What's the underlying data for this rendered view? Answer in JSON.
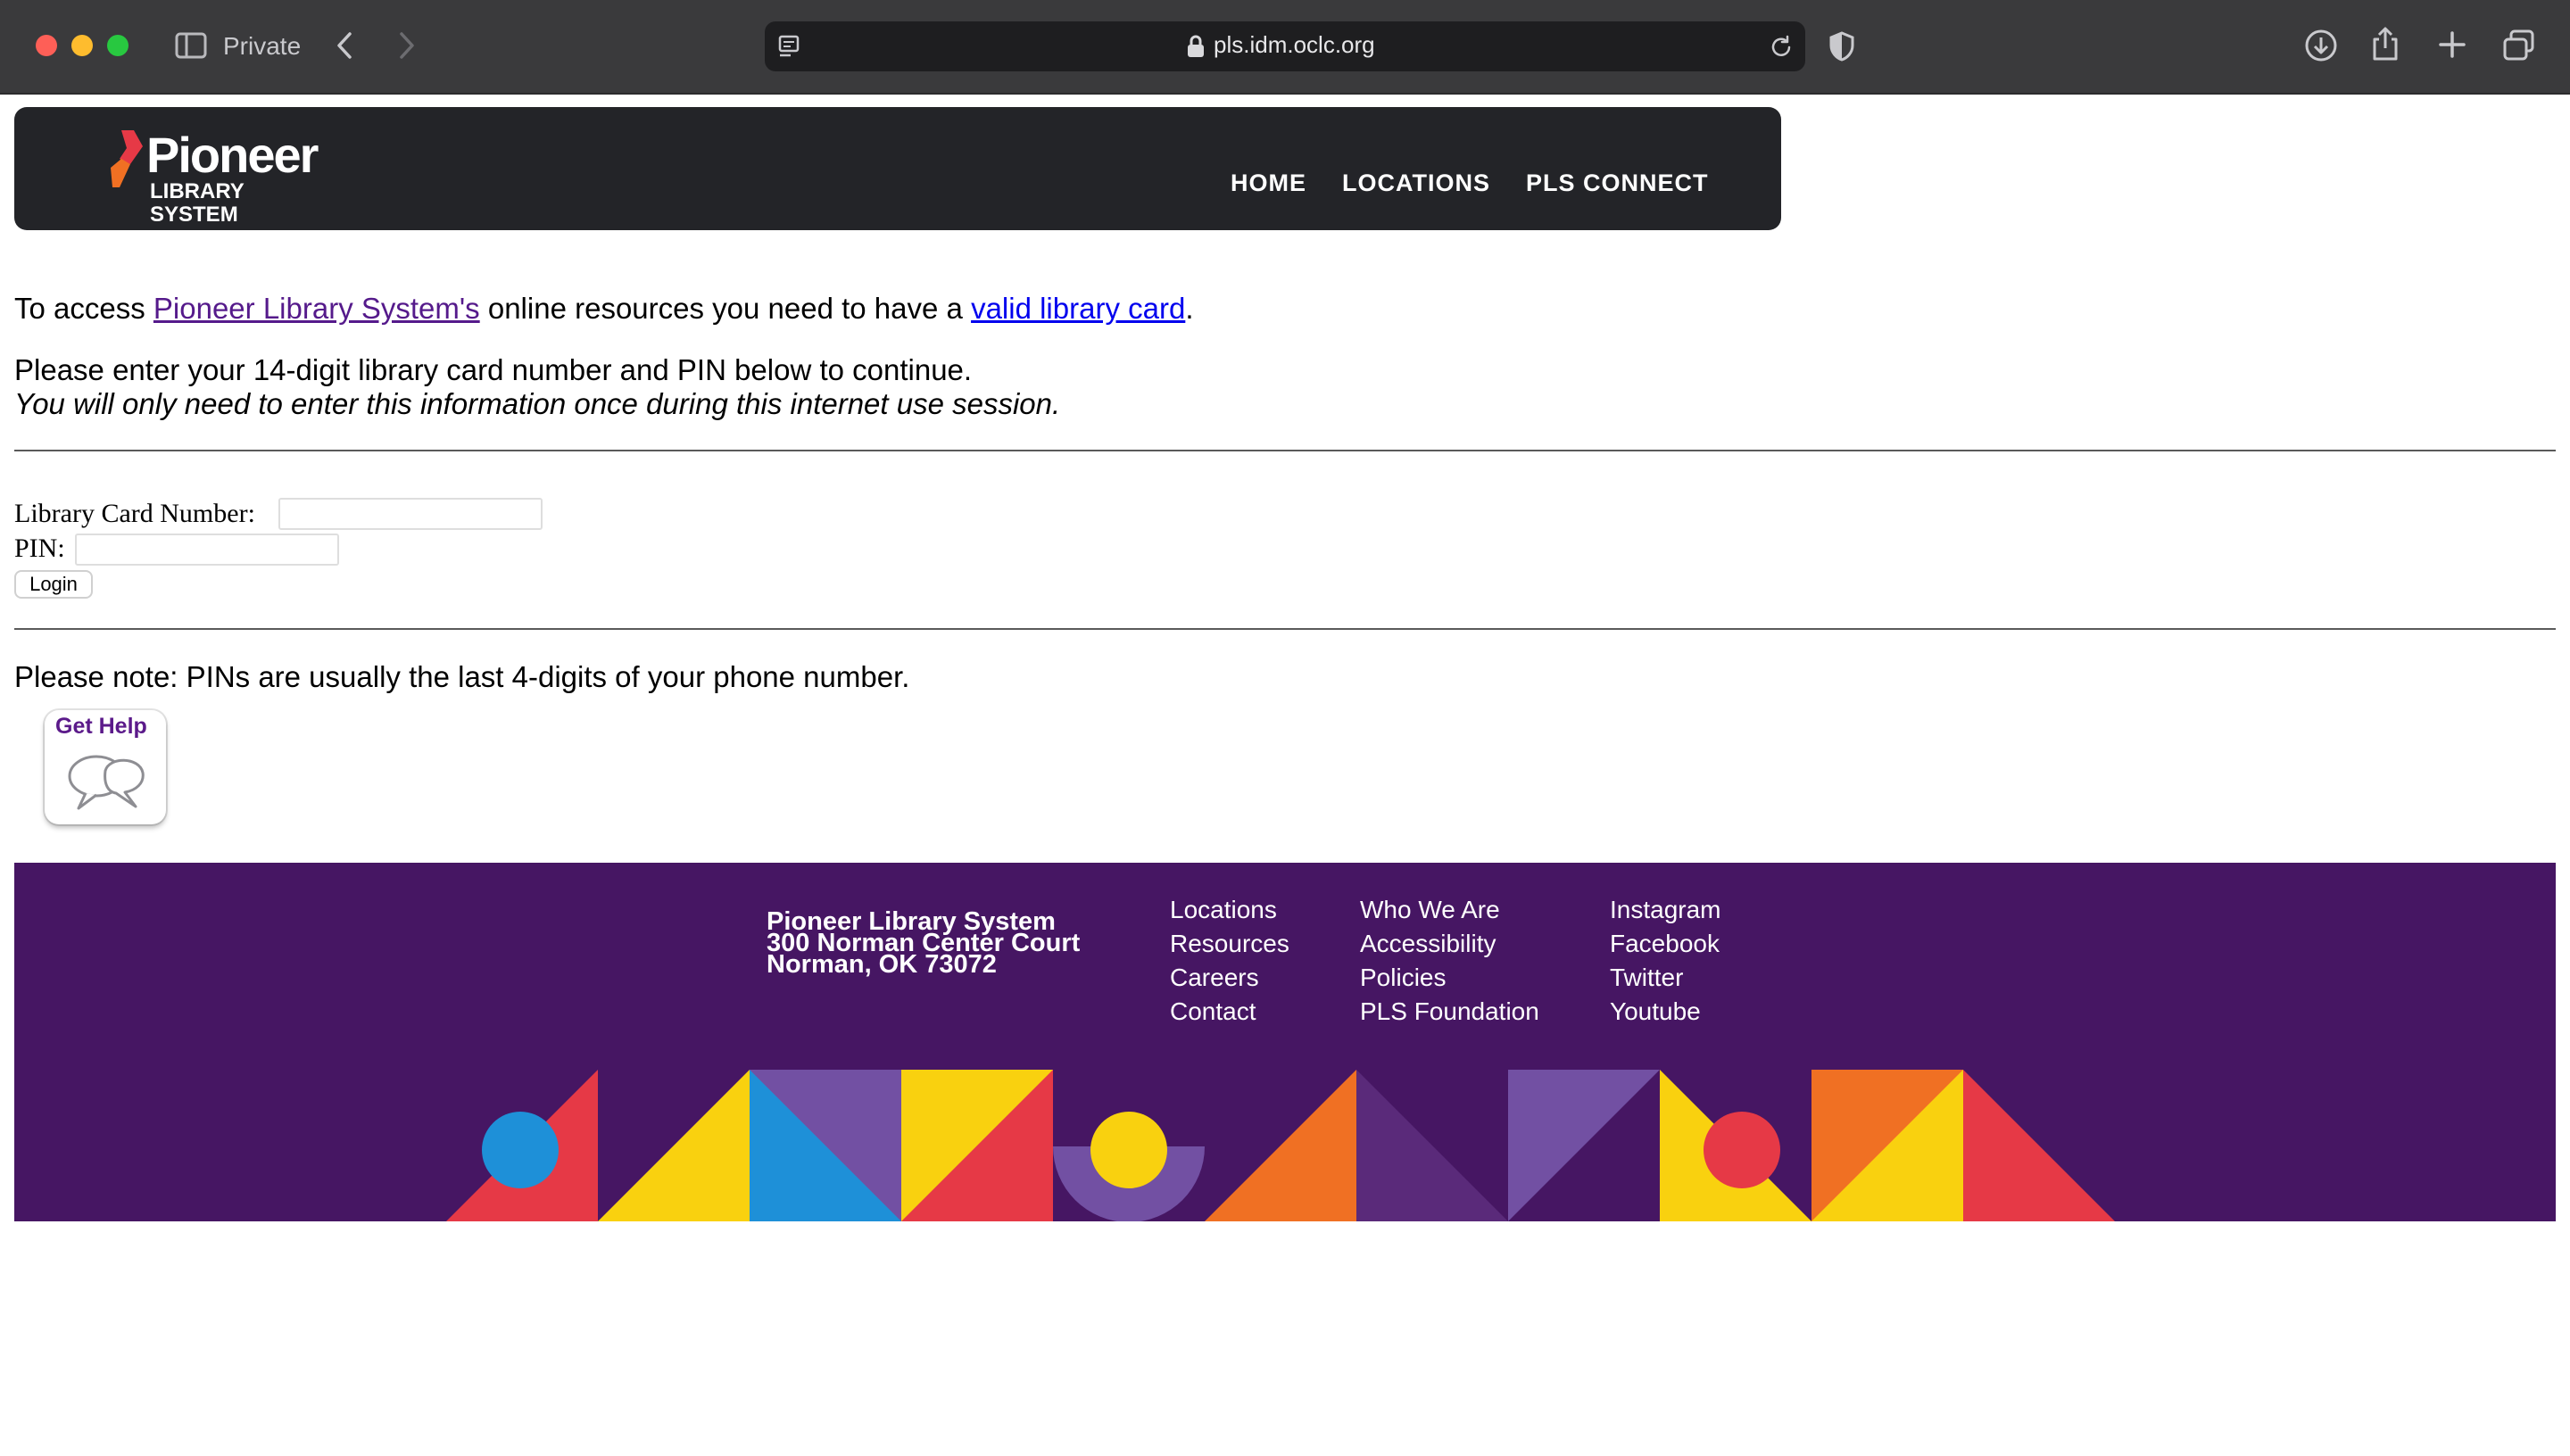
{
  "browser": {
    "mode_label": "Private",
    "url": "pls.idm.oclc.org",
    "icons": [
      "sidebar-icon",
      "back-icon",
      "forward-icon",
      "page-menu-icon",
      "lock-icon",
      "reload-icon",
      "shield-icon",
      "download-icon",
      "share-icon",
      "new-tab-icon",
      "tabs-overview-icon"
    ]
  },
  "header": {
    "logo_word": "Pioneer",
    "logo_sub": "LIBRARY SYSTEM",
    "nav": [
      "HOME",
      "LOCATIONS",
      "PLS CONNECT"
    ]
  },
  "intro": {
    "prefix": "To access ",
    "pls_link": "Pioneer Library System's",
    "middle": " online resources you need to have a ",
    "card_link": "valid library card",
    "suffix": "."
  },
  "instructions": {
    "line1": "Please enter your 14-digit library card number and PIN below to continue.",
    "line2": "You will only need to enter this information once during this internet use session."
  },
  "form": {
    "card_label": "Library Card Number:",
    "card_value": "",
    "pin_label": "PIN:",
    "pin_value": "",
    "login_label": "Login"
  },
  "note": "Please note: PINs are usually the last 4-digits of your phone number.",
  "help": {
    "label": "Get Help"
  },
  "footer": {
    "address": [
      "Pioneer Library System",
      "300 Norman Center Court",
      "Norman, OK 73072"
    ],
    "col1": [
      "Locations",
      "Resources",
      "Careers",
      "Contact"
    ],
    "col2": [
      "Who We Are",
      "Accessibility",
      "Policies",
      "PLS Foundation"
    ],
    "col3": [
      "Instagram",
      "Facebook",
      "Twitter",
      "Youtube"
    ]
  },
  "colors": {
    "header_bg": "#232428",
    "footer_bg": "#461663",
    "link_visited": "#551a8b",
    "link_unvisited": "#0000ee",
    "accent_red": "#e63946",
    "accent_yellow": "#f9d10f",
    "accent_blue": "#1e90d8",
    "accent_orange": "#f07023",
    "accent_lavender": "#7250a3"
  }
}
